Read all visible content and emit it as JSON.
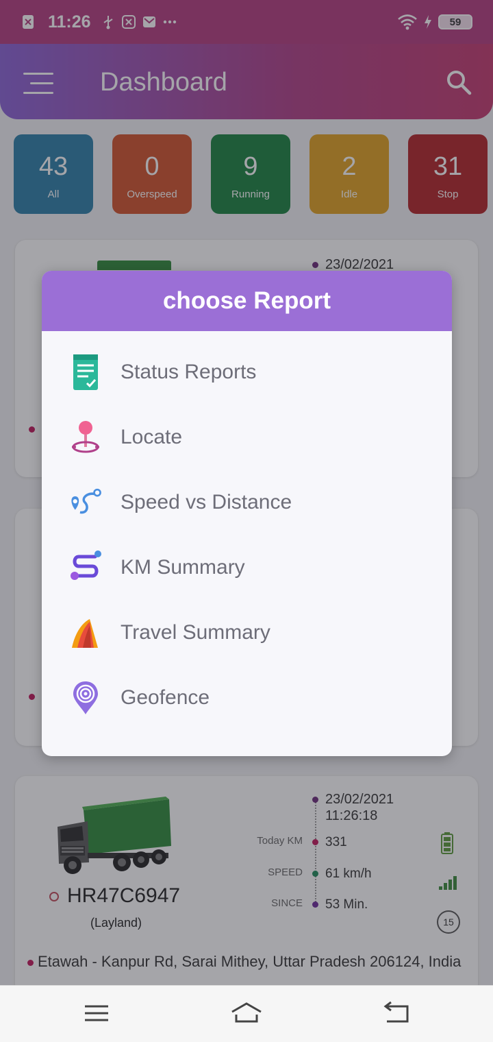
{
  "status_bar": {
    "time": "11:26",
    "battery": "59"
  },
  "header": {
    "title": "Dashboard"
  },
  "stats": [
    {
      "count": "43",
      "label": "All",
      "color": "#2b7fa8"
    },
    {
      "count": "0",
      "label": "Overspeed",
      "color": "#d0522a"
    },
    {
      "count": "9",
      "label": "Running",
      "color": "#19823f"
    },
    {
      "count": "2",
      "label": "Idle",
      "color": "#e0a020"
    },
    {
      "count": "31",
      "label": "Stop",
      "color": "#b22427"
    }
  ],
  "card_top": {
    "date": "23/02/2021"
  },
  "card_bottom": {
    "date": "23/02/2021",
    "time": "11:26:18",
    "today_km_label": "Today KM",
    "today_km": "331",
    "speed_label": "SPEED",
    "speed": "61 km/h",
    "since_label": "SINCE",
    "since": "53 Min.",
    "plate": "HR47C6947",
    "make": "(Layland)",
    "badge": "15",
    "address": "Etawah - Kanpur Rd, Sarai Mithey, Uttar Pradesh 206124, India"
  },
  "dialog": {
    "title": "choose Report",
    "options": [
      {
        "label": "Status Reports",
        "icon": "clipboard-check-icon"
      },
      {
        "label": "Locate",
        "icon": "map-pin-icon"
      },
      {
        "label": "Speed vs Distance",
        "icon": "route-icon"
      },
      {
        "label": "KM Summary",
        "icon": "path-summary-icon"
      },
      {
        "label": "Travel Summary",
        "icon": "road-icon"
      },
      {
        "label": "Geofence",
        "icon": "geofence-pin-icon"
      }
    ]
  }
}
